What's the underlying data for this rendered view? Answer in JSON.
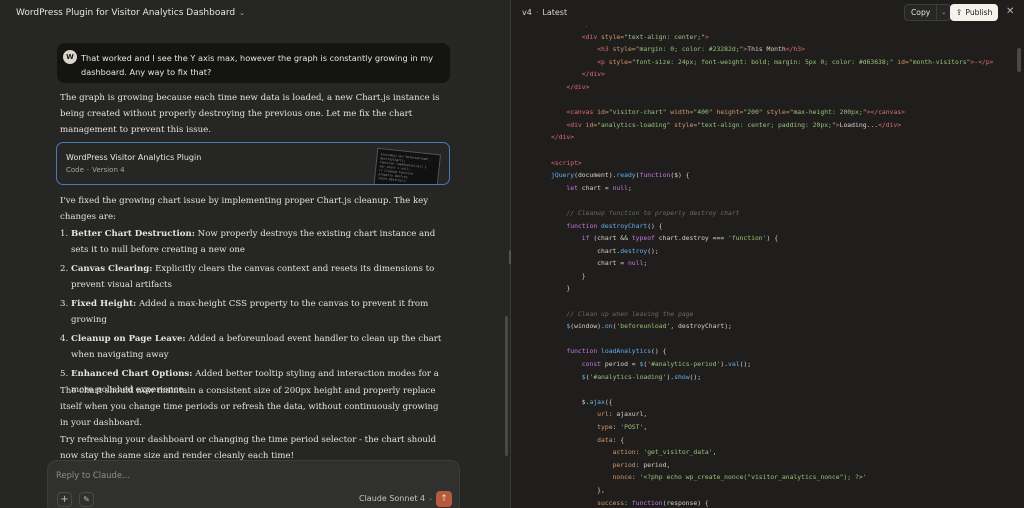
{
  "chat": {
    "title": "WordPress Plugin for Visitor Analytics Dashboard",
    "user_avatar": "W",
    "user_message": "That worked and I see the Y axis max, however the graph is constantly growing in my dashboard. Any way to fix that?",
    "reply_intro": "The graph is growing because each time new data is loaded, a new Chart.js instance is being created without properly destroying the previous one. Let me fix the chart management to prevent this issue.",
    "artifact": {
      "title": "WordPress Visitor Analytics Plugin",
      "type": "Code",
      "separator": "·",
      "version": "Version 4",
      "thumb_lines": [
        "$(window).on('beforeunload',",
        "  destroyChart);",
        "function loadAnalytics() {",
        "  var chart = null;",
        "  // Cleanup function",
        "  properly destroy",
        "  chart.destroy();"
      ]
    },
    "fix_summary": "I've fixed the growing chart issue by implementing proper Chart.js cleanup. The key changes are:",
    "changes": [
      {
        "num": "1.",
        "title": "Better Chart Destruction:",
        "text": " Now properly destroys the existing chart instance and sets it to null before creating a new one"
      },
      {
        "num": "2.",
        "title": "Canvas Clearing:",
        "text": " Explicitly clears the canvas context and resets its dimensions to prevent visual artifacts"
      },
      {
        "num": "3.",
        "title": "Fixed Height:",
        "text": " Added a max-height CSS property to the canvas to prevent it from growing"
      },
      {
        "num": "4.",
        "title": "Cleanup on Page Leave:",
        "text": " Added a beforeunload event handler to clean up the chart when navigating away"
      },
      {
        "num": "5.",
        "title": "Enhanced Chart Options:",
        "text": " Added better tooltip styling and interaction modes for a more polished experience"
      }
    ],
    "outro_1": "The chart should now maintain a consistent size of 200px height and properly replace itself when you change time periods or refresh the data, without continuously growing in your dashboard.",
    "outro_2": "Try refreshing your dashboard or changing the time period selector - the chart should now stay the same size and render cleanly each time!",
    "input_placeholder": "Reply to Claude...",
    "model": "Claude Sonnet 4",
    "icons": {
      "add": "+",
      "tools": "✎",
      "send": "↑",
      "chevron": "⌄"
    }
  },
  "artifact_panel": {
    "version": "v4",
    "separator": "·",
    "status": "Latest",
    "copy_label": "Copy",
    "publish_label": "Publish",
    "publish_icon": "⇪",
    "close_icon": "✕"
  },
  "code_lines": [
    [
      {
        "c": "tag",
        "t": "        </div>"
      }
    ],
    [
      {
        "c": "tag",
        "t": "        <div "
      },
      {
        "c": "attr",
        "t": "style="
      },
      {
        "c": "str",
        "t": "\"text-align: center;\""
      },
      {
        "c": "tag",
        "t": ">"
      }
    ],
    [
      {
        "c": "tag",
        "t": "            <h3 "
      },
      {
        "c": "attr",
        "t": "style="
      },
      {
        "c": "str",
        "t": "\"margin: 0; color: #23282d;\""
      },
      {
        "c": "tag",
        "t": ">"
      },
      {
        "c": "plain",
        "t": "This Month"
      },
      {
        "c": "tag",
        "t": "</h3>"
      }
    ],
    [
      {
        "c": "tag",
        "t": "            <p "
      },
      {
        "c": "attr",
        "t": "style="
      },
      {
        "c": "str",
        "t": "\"font-size: 24px; font-weight: bold; margin: 5px 0; color: #d63638;\""
      },
      {
        "c": "attr",
        "t": " id="
      },
      {
        "c": "str",
        "t": "\"month-visitors\""
      },
      {
        "c": "tag",
        "t": ">-</p>"
      }
    ],
    [
      {
        "c": "tag",
        "t": "        </div>"
      }
    ],
    [
      {
        "c": "tag",
        "t": "    </div>"
      }
    ],
    [
      {
        "c": "plain",
        "t": ""
      }
    ],
    [
      {
        "c": "tag",
        "t": "    <canvas "
      },
      {
        "c": "attr",
        "t": "id="
      },
      {
        "c": "str",
        "t": "\"visitor-chart\""
      },
      {
        "c": "attr",
        "t": " width="
      },
      {
        "c": "str",
        "t": "\"400\""
      },
      {
        "c": "attr",
        "t": " height="
      },
      {
        "c": "str",
        "t": "\"200\""
      },
      {
        "c": "attr",
        "t": " style="
      },
      {
        "c": "str",
        "t": "\"max-height: 200px;\""
      },
      {
        "c": "tag",
        "t": "></canvas>"
      }
    ],
    [
      {
        "c": "tag",
        "t": "    <div "
      },
      {
        "c": "attr",
        "t": "id="
      },
      {
        "c": "str",
        "t": "\"analytics-loading\""
      },
      {
        "c": "attr",
        "t": " style="
      },
      {
        "c": "str",
        "t": "\"text-align: center; padding: 20px;\""
      },
      {
        "c": "tag",
        "t": ">"
      },
      {
        "c": "plain",
        "t": "Loading..."
      },
      {
        "c": "tag",
        "t": "</div>"
      }
    ],
    [
      {
        "c": "tag",
        "t": "</div>"
      }
    ],
    [
      {
        "c": "plain",
        "t": ""
      }
    ],
    [
      {
        "c": "tag",
        "t": "<script>"
      }
    ],
    [
      {
        "c": "fn",
        "t": "jQuery"
      },
      {
        "c": "plain",
        "t": "(document)."
      },
      {
        "c": "fn",
        "t": "ready"
      },
      {
        "c": "plain",
        "t": "("
      },
      {
        "c": "kw",
        "t": "function"
      },
      {
        "c": "plain",
        "t": "($) {"
      }
    ],
    [
      {
        "c": "kw",
        "t": "    let"
      },
      {
        "c": "plain",
        "t": " chart = "
      },
      {
        "c": "kw",
        "t": "null"
      },
      {
        "c": "plain",
        "t": ";"
      }
    ],
    [
      {
        "c": "plain",
        "t": ""
      }
    ],
    [
      {
        "c": "com",
        "t": "    // Cleanup function to properly destroy chart"
      }
    ],
    [
      {
        "c": "kw",
        "t": "    function"
      },
      {
        "c": "fn",
        "t": " destroyChart"
      },
      {
        "c": "plain",
        "t": "() {"
      }
    ],
    [
      {
        "c": "kw",
        "t": "        if"
      },
      {
        "c": "plain",
        "t": " (chart && "
      },
      {
        "c": "kw",
        "t": "typeof"
      },
      {
        "c": "plain",
        "t": " chart.destroy === "
      },
      {
        "c": "str",
        "t": "'function'"
      },
      {
        "c": "plain",
        "t": ") {"
      }
    ],
    [
      {
        "c": "plain",
        "t": "            chart."
      },
      {
        "c": "fn",
        "t": "destroy"
      },
      {
        "c": "plain",
        "t": "();"
      }
    ],
    [
      {
        "c": "plain",
        "t": "            chart = "
      },
      {
        "c": "kw",
        "t": "null"
      },
      {
        "c": "plain",
        "t": ";"
      }
    ],
    [
      {
        "c": "plain",
        "t": "        }"
      }
    ],
    [
      {
        "c": "plain",
        "t": "    }"
      }
    ],
    [
      {
        "c": "plain",
        "t": ""
      }
    ],
    [
      {
        "c": "com",
        "t": "    // Clean up when leaving the page"
      }
    ],
    [
      {
        "c": "fn",
        "t": "    $"
      },
      {
        "c": "plain",
        "t": "(window)."
      },
      {
        "c": "fn",
        "t": "on"
      },
      {
        "c": "plain",
        "t": "("
      },
      {
        "c": "str",
        "t": "'beforeunload'"
      },
      {
        "c": "plain",
        "t": ", destroyChart);"
      }
    ],
    [
      {
        "c": "plain",
        "t": ""
      }
    ],
    [
      {
        "c": "kw",
        "t": "    function"
      },
      {
        "c": "fn",
        "t": " loadAnalytics"
      },
      {
        "c": "plain",
        "t": "() {"
      }
    ],
    [
      {
        "c": "kw",
        "t": "        const"
      },
      {
        "c": "plain",
        "t": " period = "
      },
      {
        "c": "fn",
        "t": "$"
      },
      {
        "c": "plain",
        "t": "("
      },
      {
        "c": "str",
        "t": "'#analytics-period'"
      },
      {
        "c": "plain",
        "t": ")."
      },
      {
        "c": "fn",
        "t": "val"
      },
      {
        "c": "plain",
        "t": "();"
      }
    ],
    [
      {
        "c": "fn",
        "t": "        $"
      },
      {
        "c": "plain",
        "t": "("
      },
      {
        "c": "str",
        "t": "'#analytics-loading'"
      },
      {
        "c": "plain",
        "t": ")."
      },
      {
        "c": "fn",
        "t": "show"
      },
      {
        "c": "plain",
        "t": "();"
      }
    ],
    [
      {
        "c": "plain",
        "t": ""
      }
    ],
    [
      {
        "c": "plain",
        "t": "        $."
      },
      {
        "c": "fn",
        "t": "ajax"
      },
      {
        "c": "plain",
        "t": "({"
      }
    ],
    [
      {
        "c": "attr",
        "t": "            url"
      },
      {
        "c": "plain",
        "t": ": ajaxurl,"
      }
    ],
    [
      {
        "c": "attr",
        "t": "            type"
      },
      {
        "c": "plain",
        "t": ": "
      },
      {
        "c": "str",
        "t": "'POST'"
      },
      {
        "c": "plain",
        "t": ","
      }
    ],
    [
      {
        "c": "attr",
        "t": "            data"
      },
      {
        "c": "plain",
        "t": ": {"
      }
    ],
    [
      {
        "c": "attr",
        "t": "                action"
      },
      {
        "c": "plain",
        "t": ": "
      },
      {
        "c": "str",
        "t": "'get_visitor_data'"
      },
      {
        "c": "plain",
        "t": ","
      }
    ],
    [
      {
        "c": "attr",
        "t": "                period"
      },
      {
        "c": "plain",
        "t": ": period,"
      }
    ],
    [
      {
        "c": "attr",
        "t": "                nonce"
      },
      {
        "c": "plain",
        "t": ": "
      },
      {
        "c": "str",
        "t": "'<?php echo wp_create_nonce(\"visitor_analytics_nonce\"); ?>'"
      }
    ],
    [
      {
        "c": "plain",
        "t": "            },"
      }
    ],
    [
      {
        "c": "attr",
        "t": "            success"
      },
      {
        "c": "plain",
        "t": ": "
      },
      {
        "c": "kw",
        "t": "function"
      },
      {
        "c": "plain",
        "t": "(response) {"
      }
    ]
  ]
}
